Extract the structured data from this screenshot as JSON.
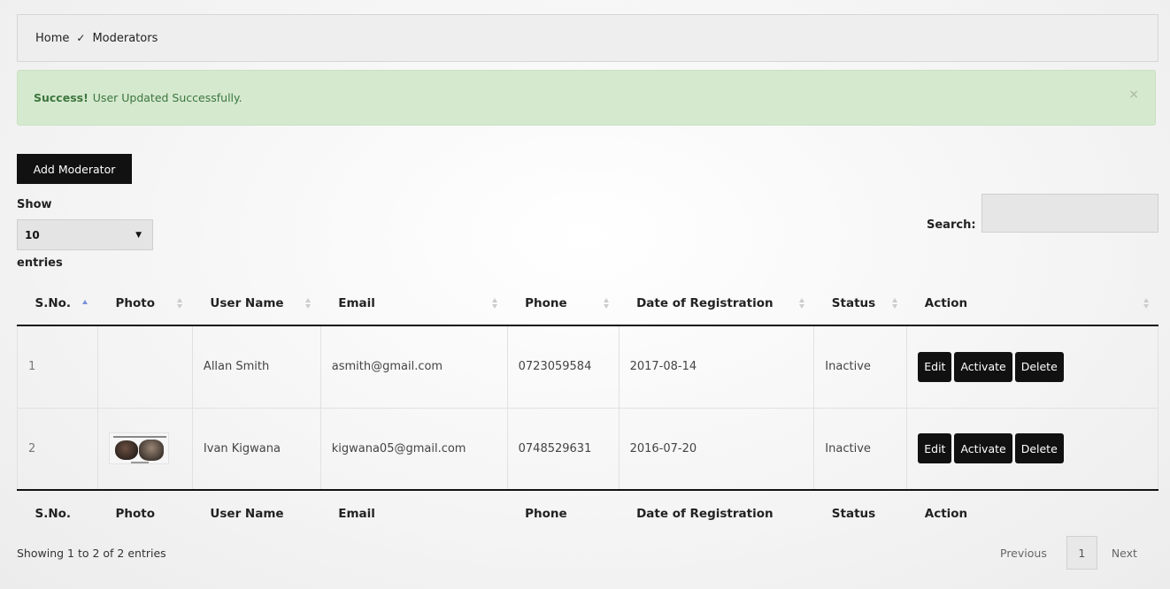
{
  "breadcrumb": {
    "home": "Home",
    "separator": "✓",
    "current": "Moderators"
  },
  "alert": {
    "strong": "Success!",
    "message": "User Updated Successfully.",
    "close": "×"
  },
  "toolbar": {
    "add_label": "Add Moderator"
  },
  "length": {
    "show_label": "Show",
    "selected": "10",
    "entries_label": "entries"
  },
  "search": {
    "label": "Search:",
    "value": ""
  },
  "table": {
    "columns": [
      "S.No.",
      "Photo",
      "User Name",
      "Email",
      "Phone",
      "Date of Registration",
      "Status",
      "Action"
    ],
    "sorted_column": "S.No.",
    "rows": [
      {
        "sno": "1",
        "photo": "",
        "username": "Allan Smith",
        "email": "asmith@gmail.com",
        "phone": "0723059584",
        "date": "2017-08-14",
        "status": "Inactive"
      },
      {
        "sno": "2",
        "photo": "user-photo-thumbnail",
        "username": "Ivan Kigwana",
        "email": "kigwana05@gmail.com",
        "phone": "0748529631",
        "date": "2016-07-20",
        "status": "Inactive"
      }
    ],
    "actions": {
      "edit": "Edit",
      "activate": "Activate",
      "delete": "Delete"
    }
  },
  "footer": {
    "info": "Showing 1 to 2 of 2 entries"
  },
  "pagination": {
    "previous": "Previous",
    "current": "1",
    "next": "Next"
  },
  "colors": {
    "alert_bg": "#d5e9cf",
    "alert_text": "#3c763d",
    "button_bg": "#111111",
    "sort_active": "#7b8fd6"
  }
}
